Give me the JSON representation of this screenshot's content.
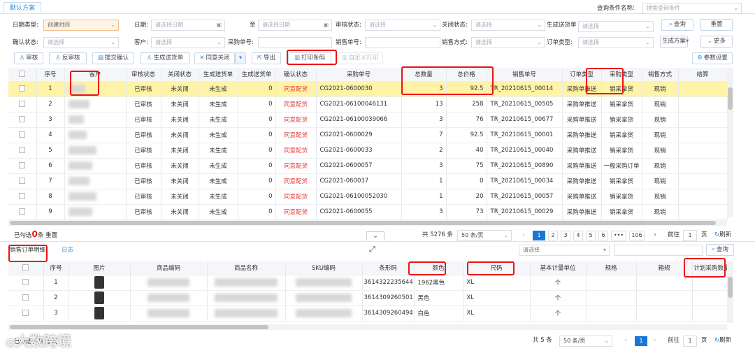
{
  "tab_default": "默认方案",
  "query_cond": {
    "label": "查询条件名称:",
    "placeholder": "搜索查询条件"
  },
  "filters": {
    "date_type": {
      "label": "日期类型:",
      "value": "创建时间"
    },
    "date": {
      "label": "日期:",
      "placeholder": "请选择日期"
    },
    "to": {
      "label": "至",
      "placeholder": "请选择日期"
    },
    "audit": {
      "label": "审核状态:",
      "placeholder": "请选择"
    },
    "close": {
      "label": "关闭状态:",
      "placeholder": "请选择"
    },
    "gen": {
      "label": "生成送货单",
      "placeholder": "请选择"
    },
    "confirm": {
      "label": "确认状态:",
      "placeholder": "请选择"
    },
    "customer": {
      "label": "客户:",
      "placeholder": "请选择"
    },
    "po": {
      "label": "采购单号:"
    },
    "so": {
      "label": "销售单号:"
    },
    "sale_mode": {
      "label": "销售方式:",
      "placeholder": "请选择"
    },
    "order_type": {
      "label": "订单类型:",
      "placeholder": "请选择"
    }
  },
  "buttons": {
    "query": "查询",
    "reset": "重置",
    "gen_plan": "生成方案",
    "more": "更多",
    "params": "参数设置"
  },
  "toolbar": [
    "审核",
    "反审核",
    "提交确认",
    "生成送货单",
    "同意关闭",
    "导出",
    "打印条码",
    "自定义打印"
  ],
  "top_columns": [
    "序号",
    "客户",
    "审核状态",
    "关闭状态",
    "生成送货单",
    "生成送货单",
    "确认状态",
    "采购单号",
    "总数量",
    "总价格",
    "销售单号",
    "订单类型",
    "采购类型",
    "销售方式",
    "结算"
  ],
  "top_rows": [
    [
      "1",
      "已审核",
      "未关闭",
      "未生成",
      "0",
      "同意配货",
      "CG2021-0600030",
      "3",
      "92.5",
      "TR_20210615_00014",
      "采购单推送",
      "销采拿货",
      "现销"
    ],
    [
      "2",
      "已审核",
      "未关闭",
      "未生成",
      "0",
      "同意配货",
      "CG2021-06100046131",
      "13",
      "258",
      "TR_20210615_00505",
      "采购单推送",
      "销采拿货",
      "现销"
    ],
    [
      "3",
      "已审核",
      "未关闭",
      "未生成",
      "0",
      "同意配货",
      "CG2021-06100039066",
      "3",
      "76",
      "TR_20210615_00677",
      "采购单推送",
      "销采拿货",
      "现销"
    ],
    [
      "4",
      "已审核",
      "未关闭",
      "未生成",
      "0",
      "同意配货",
      "CG2021-0600029",
      "7",
      "92.5",
      "TR_20210615_00001",
      "采购单推送",
      "销采拿货",
      "现销"
    ],
    [
      "5",
      "已审核",
      "未关闭",
      "未生成",
      "0",
      "同意配货",
      "CG2021-0600033",
      "2",
      "40",
      "TR_20210615_00040",
      "采购单推送",
      "销采拿货",
      "现销"
    ],
    [
      "6",
      "已审核",
      "未关闭",
      "未生成",
      "0",
      "同意配货",
      "CG2021-0600057",
      "3",
      "75",
      "TR_20210615_00890",
      "采购单推送",
      "一般采购订单",
      "现销"
    ],
    [
      "7",
      "已审核",
      "未关闭",
      "未生成",
      "0",
      "同意配货",
      "CG2021-060037",
      "1",
      "0",
      "TR_20210615_00034",
      "采购单推送",
      "销采拿货",
      "现销"
    ],
    [
      "8",
      "已审核",
      "未关闭",
      "未生成",
      "0",
      "同意配货",
      "CG2021-06100052030",
      "1",
      "20",
      "TR_20210615_00057",
      "采购单推送",
      "销采拿货",
      "现销"
    ],
    [
      "9",
      "已审核",
      "未关闭",
      "未生成",
      "0",
      "同意配货",
      "CG2021-0600055",
      "3",
      "73",
      "TR_20210615_00029",
      "采购单推送",
      "销采拿货",
      "现销"
    ]
  ],
  "top_footer": {
    "selected_prefix": "已勾选",
    "selected_count": "0",
    "selected_suffix": "条",
    "reset": "重置"
  },
  "pager_top": {
    "total": "共 5276 条",
    "size": "50 条/页",
    "pages": [
      "1",
      "2",
      "3",
      "4",
      "5",
      "6",
      "•••",
      "106"
    ],
    "goto": "前往",
    "goto_val": "1",
    "page_unit": "页",
    "refresh": "刷新"
  },
  "bottom_tabs": [
    "销售订单明细",
    "日志"
  ],
  "bottom_select": "请选择",
  "bottom_query": "查询",
  "bottom_columns": [
    "序号",
    "图片",
    "商品编码",
    "商品名称",
    "SKU编码",
    "条形码",
    "颜色",
    "尺码",
    "基本计量单位",
    "规格",
    "箱规",
    "计划采购数量"
  ],
  "bottom_rows": [
    [
      "1",
      "3614322235644",
      "1962黑色",
      "XL",
      "个"
    ],
    [
      "2",
      "3614309260501",
      "黑色",
      "XL",
      "个"
    ],
    [
      "3",
      "3614309260494",
      "白色",
      "XL",
      "个"
    ]
  ],
  "bottom_footer": {
    "selected_prefix": "已勾选",
    "selected_count": "0",
    "selected_suffix": "条",
    "reset": "重置"
  },
  "pager_bottom": {
    "total": "共 5 条",
    "size": "50 条/页",
    "page": "1",
    "goto": "前往",
    "goto_val": "1",
    "page_unit": "页",
    "refresh": "刷新"
  },
  "watermark": "大数跨境"
}
